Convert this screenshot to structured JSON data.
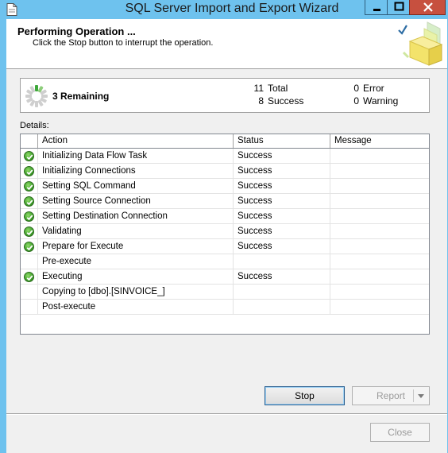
{
  "window": {
    "title": "SQL Server Import and Export Wizard"
  },
  "header": {
    "title": "Performing Operation ...",
    "subtitle": "Click the Stop button to interrupt the operation."
  },
  "summary": {
    "remaining_label": "3 Remaining",
    "total_count": "11",
    "total_label": "Total",
    "success_count": "8",
    "success_label": "Success",
    "error_count": "0",
    "error_label": "Error",
    "warning_count": "0",
    "warning_label": "Warning"
  },
  "details": {
    "label": "Details:",
    "columns": {
      "action": "Action",
      "status": "Status",
      "message": "Message"
    },
    "rows": [
      {
        "icon": "success-icon",
        "action": "Initializing Data Flow Task",
        "status": "Success",
        "message": ""
      },
      {
        "icon": "success-icon",
        "action": "Initializing Connections",
        "status": "Success",
        "message": ""
      },
      {
        "icon": "success-icon",
        "action": "Setting SQL Command",
        "status": "Success",
        "message": ""
      },
      {
        "icon": "success-icon",
        "action": "Setting Source Connection",
        "status": "Success",
        "message": ""
      },
      {
        "icon": "success-icon",
        "action": "Setting Destination Connection",
        "status": "Success",
        "message": ""
      },
      {
        "icon": "success-icon",
        "action": "Validating",
        "status": "Success",
        "message": ""
      },
      {
        "icon": "success-icon",
        "action": "Prepare for Execute",
        "status": "Success",
        "message": ""
      },
      {
        "icon": "",
        "action": "Pre-execute",
        "status": "",
        "message": ""
      },
      {
        "icon": "success-icon",
        "action": "Executing",
        "status": "Success",
        "message": ""
      },
      {
        "icon": "",
        "action": "Copying to [dbo].[SINVOICE_]",
        "status": "",
        "message": ""
      },
      {
        "icon": "",
        "action": "Post-execute",
        "status": "",
        "message": ""
      }
    ]
  },
  "buttons": {
    "stop": "Stop",
    "report": "Report",
    "close": "Close"
  },
  "colors": {
    "titlebar": "#6ec2ee",
    "close_button": "#c7503f",
    "success_green": "#3f9e2a"
  }
}
